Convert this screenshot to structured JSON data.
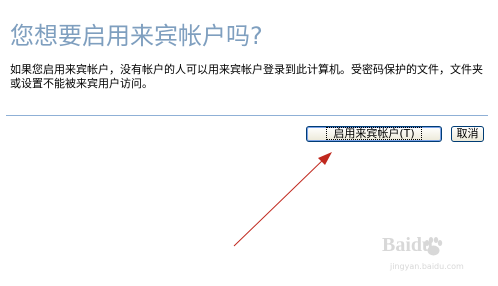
{
  "dialog": {
    "title": "您想要启用来宾帐户吗?",
    "description": "如果您启用来宾帐户，没有帐户的人可以用来宾帐户登录到此计算机。受密码保护的文件，文件夹或设置不能被来宾用户访问。",
    "buttons": {
      "enable_guest": "启用来宾帐户(T)",
      "cancel": "取消"
    }
  },
  "watermark": {
    "brand": "Baidu",
    "subtitle": "jingyan.baidu.com"
  },
  "colors": {
    "title": "#7f9fbf",
    "separator": "#8fb0d6",
    "annotation_arrow": "#c0281e",
    "button_border": "#003c74"
  }
}
